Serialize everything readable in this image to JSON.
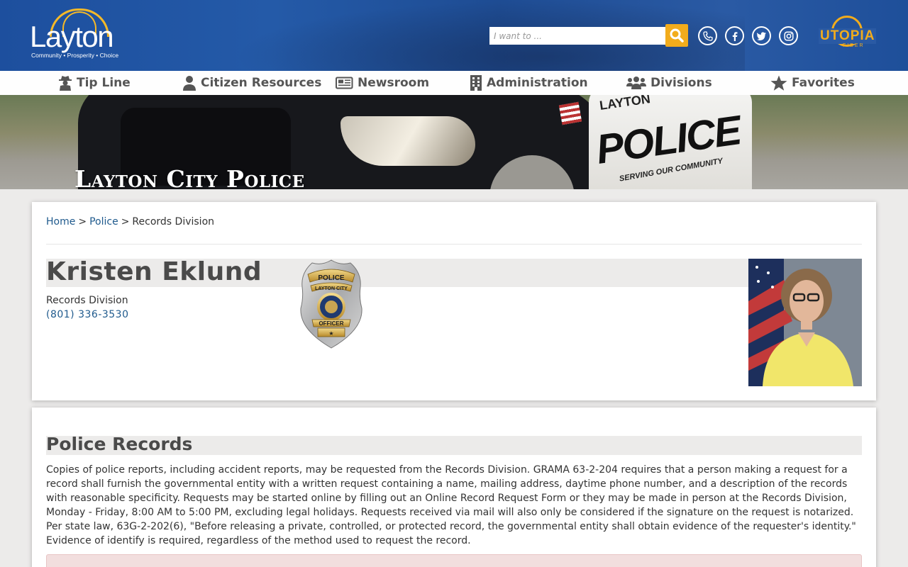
{
  "header": {
    "logo_text": "Layton",
    "logo_tagline": "Community • Prosperity • Choice",
    "search_placeholder": "I want to ...",
    "social": [
      "phone-icon",
      "facebook-icon",
      "twitter-icon",
      "instagram-icon"
    ],
    "partner_logo": "UTOPIA",
    "partner_logo_sub": "FIBER",
    "accent_color": "#f2ac1c",
    "brand_color": "#245aa8"
  },
  "nav": {
    "items": [
      {
        "label": "Tip Line",
        "icon": "detective-icon"
      },
      {
        "label": "Citizen Resources",
        "icon": "user-icon"
      },
      {
        "label": "Newsroom",
        "icon": "newspaper-icon"
      },
      {
        "label": "Administration",
        "icon": "building-icon"
      },
      {
        "label": "Divisions",
        "icon": "users-icon"
      },
      {
        "label": "Favorites",
        "icon": "star-icon"
      }
    ]
  },
  "banner": {
    "title": "Layton City Police",
    "vehicle_text": "POLICE",
    "vehicle_small_text": "LAYTON",
    "vehicle_slogan": "SERVING OUR COMMUNITY"
  },
  "breadcrumb": {
    "home": "Home",
    "sep": ">",
    "police": "Police",
    "current": "Records Division"
  },
  "profile": {
    "name": "Kristen Eklund",
    "department": "Records Division",
    "phone": "(801) 336-3530",
    "badge_top": "POLICE",
    "badge_city": "LAYTON CITY",
    "badge_bottom": "OFFICER"
  },
  "records": {
    "title": "Police Records",
    "body": "Copies of police reports, including accident reports, may be requested from the Records Division. GRAMA 63-2-204 requires that a person making a request for a record shall furnish the governmental entity with a written request containing a name, mailing address, daytime phone number, and a description of the records with reasonable specificity. Requests may be started online by filling out an Online Record Request Form or they may be made in person at the Records Division, Monday - Friday, 8:00 AM to 5:00 PM, excluding legal holidays. Requests received via mail will also only be considered if the signature on the request is notarized. Per state law, 63G-2-202(6), \"Before releasing a private, controlled, or protected record, the governmental entity shall obtain evidence of the requester's identity.\" Evidence of identify is required, regardless of the method used to request the record."
  }
}
